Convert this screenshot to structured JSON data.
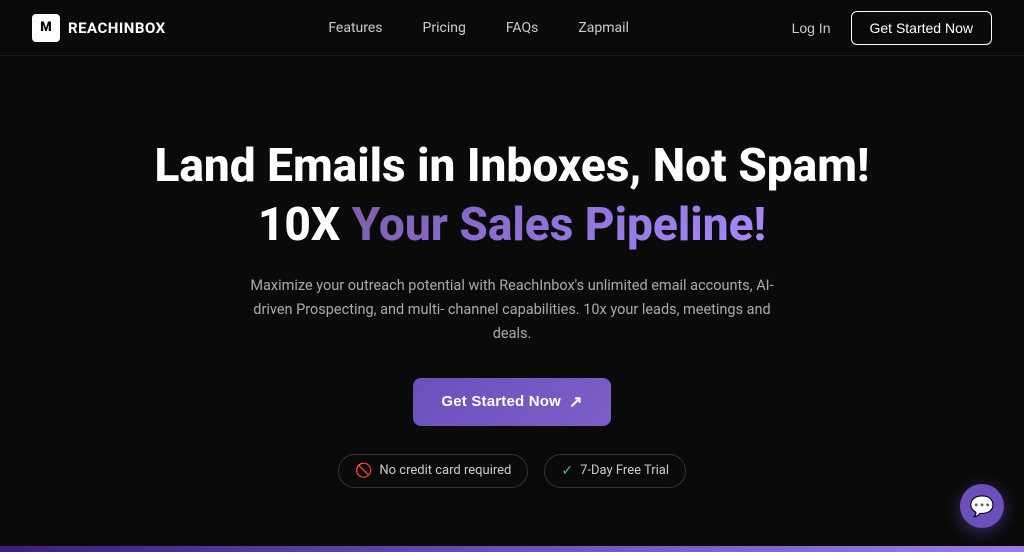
{
  "brand": {
    "logo_letter": "M",
    "name": "REACHINBOX"
  },
  "nav": {
    "links": [
      {
        "label": "Features",
        "id": "features"
      },
      {
        "label": "Pricing",
        "id": "pricing"
      },
      {
        "label": "FAQs",
        "id": "faqs"
      },
      {
        "label": "Zapmail",
        "id": "zapmail"
      }
    ],
    "login_label": "Log In",
    "cta_label": "Get Started Now"
  },
  "hero": {
    "headline_line1": "Land Emails in Inboxes, Not Spam!",
    "headline_line2_plain": "10X ",
    "headline_line2_gradient": "Your Sales Pipeline!",
    "description": "Maximize your outreach potential with ReachInbox's unlimited email accounts, AI-driven Prospecting, and multi- channel capabilities. 10x your leads, meetings and deals.",
    "cta_label": "Get Started Now",
    "cta_arrow": "↗",
    "badge_no_card": "No credit card required",
    "badge_trial": "7-Day Free Trial"
  },
  "chat": {
    "icon": "💬"
  }
}
